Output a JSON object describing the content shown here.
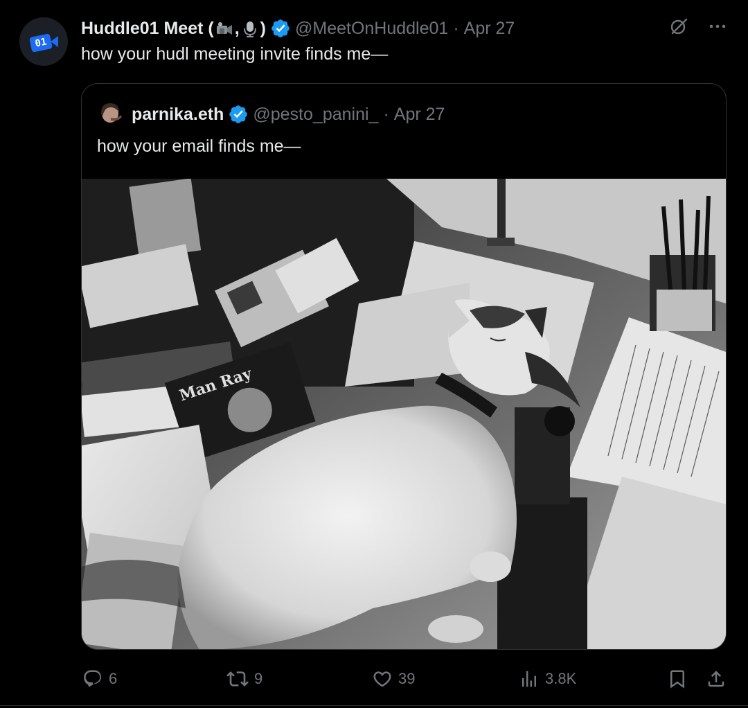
{
  "tweet": {
    "author": {
      "display_name_prefix": "Huddle01 Meet (",
      "display_name_sep": ",",
      "display_name_suffix": ")",
      "handle": "@MeetOnHuddle01",
      "date": "Apr 27",
      "dot": "·",
      "avatar_text": "01"
    },
    "text": "how your hudl meeting invite finds me—",
    "top_actions": {
      "grok_icon": "grok-icon",
      "more_label": "···"
    },
    "quote": {
      "author": {
        "display_name": "parnika.eth",
        "handle": "@pesto_panini_",
        "date": "Apr 27",
        "dot": "·"
      },
      "text": "how your email finds me—",
      "image": {
        "magazine_label": "Man Ray"
      }
    },
    "actions": {
      "replies": "6",
      "reposts": "9",
      "likes": "39",
      "views": "3.8K"
    }
  },
  "colors": {
    "background": "#000000",
    "text": "#e7e9ea",
    "muted": "#71767b",
    "border": "#2f3336",
    "verified": "#1d9bf0",
    "avatar_blue": "#1d6bf3"
  }
}
